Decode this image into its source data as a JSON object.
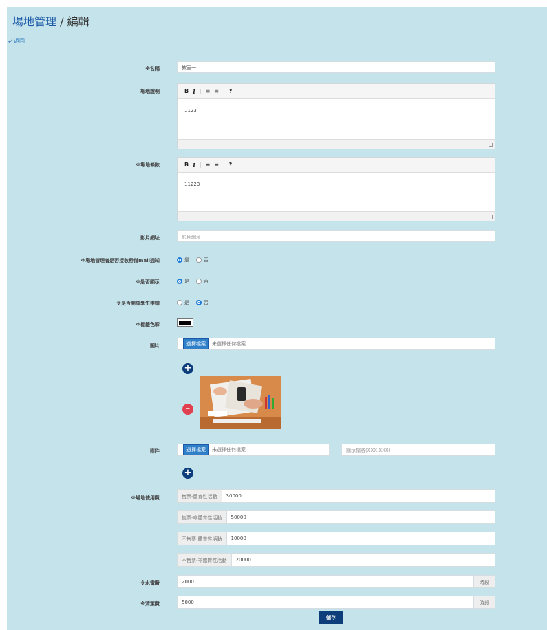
{
  "header": {
    "title": "場地管理",
    "separator": " / ",
    "subtitle": "編輯"
  },
  "back": {
    "label": "返回"
  },
  "name": {
    "label": "※名稱",
    "value": "教室一"
  },
  "description": {
    "label": "場地說明",
    "body": "1123"
  },
  "terms": {
    "label": "※場地條款",
    "body": "11223"
  },
  "video": {
    "label": "影片網址",
    "placeholder": "影片網址"
  },
  "mail_notify": {
    "label": "※場地管理者是否接收租借mail通知",
    "yes": "是",
    "no": "否",
    "selected": "是"
  },
  "display": {
    "label": "※是否顯示",
    "yes": "是",
    "no": "否",
    "selected": "是"
  },
  "student_apply": {
    "label": "※是否開放學生申請",
    "yes": "是",
    "no": "否",
    "selected": "否"
  },
  "tag_color": {
    "label": "※標籤色彩",
    "color": "#000000"
  },
  "image": {
    "label": "圖片",
    "button": "選擇檔案",
    "status": "未選擇任何檔案"
  },
  "attachment": {
    "label": "附件",
    "button": "選擇檔案",
    "status": "未選擇任何檔案",
    "display_name_placeholder": "顯示檔名(XXX.XXX)"
  },
  "usage_fee": {
    "label": "※場地使用費",
    "rows": [
      {
        "tag": "售票-體育性活動",
        "value": "30000"
      },
      {
        "tag": "售票-非體育性活動",
        "value": "50000"
      },
      {
        "tag": "不售票-體育性活動",
        "value": "10000"
      },
      {
        "tag": "不售票-非體育性活動",
        "value": "20000"
      }
    ]
  },
  "utilities": {
    "label": "※水電費",
    "value": "2000",
    "unit": "時段"
  },
  "cleaning": {
    "label": "※清潔費",
    "value": "5000",
    "unit": "時段"
  },
  "save": {
    "label": "儲存"
  },
  "colors": {
    "panel": "#c4e3eb",
    "title": "#1c5aa8",
    "primary": "#0d3d7a",
    "danger": "#e04050",
    "file_button": "#2f7fc9"
  }
}
